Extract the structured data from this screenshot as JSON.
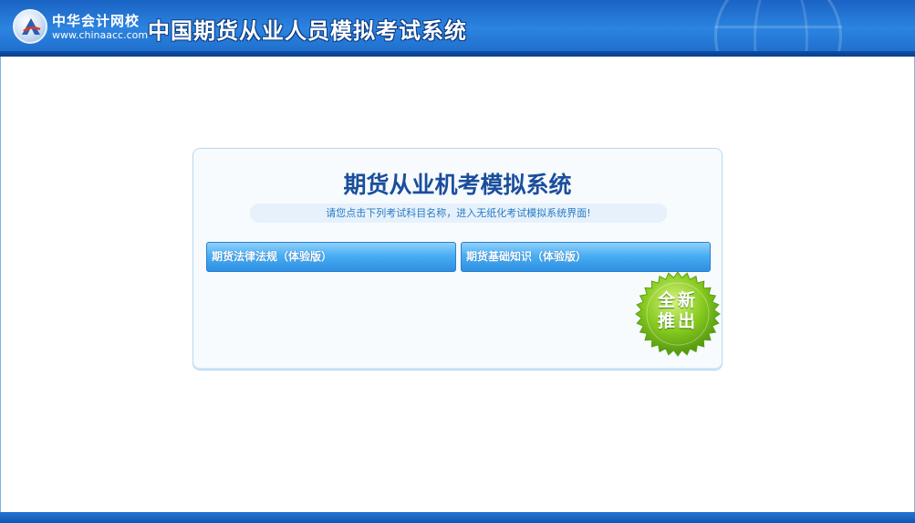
{
  "header": {
    "logo_cn": "中华会计网校",
    "logo_url": "www.chinaacc.com",
    "system_title": "中国期货从业人员模拟考试系统"
  },
  "panel": {
    "title": "期货从业机考模拟系统",
    "subtitle": "请您点击下列考试科目名称，进入无纸化考试模拟系统界面!",
    "exams": [
      {
        "label": "期货法律法规（体验版）"
      },
      {
        "label": "期货基础知识（体验版）"
      }
    ],
    "badge": {
      "line1": "全新",
      "line2": "推出"
    }
  },
  "colors": {
    "header_blue": "#2c84e0",
    "title_blue": "#1b4e9c",
    "button_blue": "#4aaef3",
    "badge_green": "#7cc61e"
  }
}
